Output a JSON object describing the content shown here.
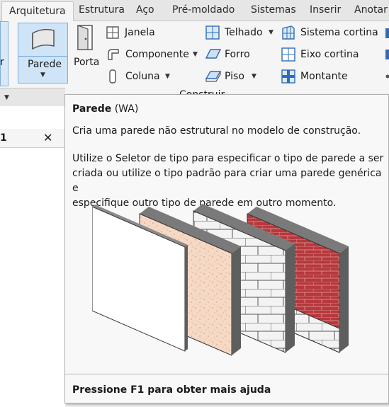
{
  "tabs": [
    "Arquitetura",
    "Estrutura",
    "Aço",
    "Pré-moldado",
    "Sistemas",
    "Inserir",
    "Anotar"
  ],
  "ribbon": {
    "left_cut_label": "r",
    "parede": "Parede",
    "porta": "Porta",
    "janela": "Janela",
    "componente": "Componente",
    "coluna": "Coluna",
    "telhado": "Telhado",
    "forro": "Forro",
    "piso": "Piso",
    "sistema_cortina": "Sistema cortina",
    "eixo_cortina": "Eixo cortina",
    "montante": "Montante",
    "panel_label": "Construir"
  },
  "document": {
    "tab_label": "1",
    "close": "✕"
  },
  "tooltip": {
    "title": "Parede",
    "shortcut": "(WA)",
    "description": "Cria uma parede não estrutural no modelo de construção.",
    "detail_lines": [
      "Utilize o Seletor de tipo para especificar o tipo de parede a ser",
      "criada ou utilize o tipo padrão para criar uma parede genérica e",
      "especifique outro tipo de parede em outro momento."
    ],
    "help": "Pressione F1 para obter mais ajuda"
  },
  "colors": {
    "accent": "#cfe4f7",
    "brick": "#b5393d",
    "stucco": "#f6d9c4",
    "icon_blue": "#2f6db5"
  }
}
